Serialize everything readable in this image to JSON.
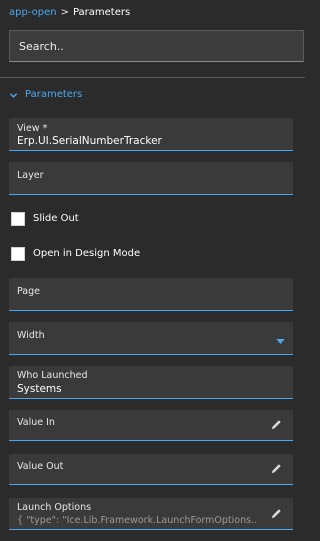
{
  "breadcrumb": {
    "parent": "app-open",
    "separator": ">",
    "current": "Parameters"
  },
  "search": {
    "placeholder": "Search.."
  },
  "section": {
    "title": "Parameters",
    "expanded": true
  },
  "fields": {
    "view": {
      "label": "View *",
      "value": "Erp.UI.SerialNumberTracker"
    },
    "layer": {
      "label": "Layer",
      "value": ""
    },
    "slide_out": {
      "label": "Slide Out",
      "checked": false
    },
    "open_in_design_mode": {
      "label": "Open in Design Mode",
      "checked": false
    },
    "page": {
      "label": "Page",
      "value": ""
    },
    "width": {
      "label": "Width",
      "value": ""
    },
    "who_launched": {
      "label": "Who Launched",
      "value": "Systems"
    },
    "value_in": {
      "label": "Value In",
      "value": ""
    },
    "value_out": {
      "label": "Value Out",
      "value": ""
    },
    "launch_options": {
      "label": "Launch Options",
      "value": "{ \"type\": \"Ice.Lib.Framework.LaunchFormOptions..."
    }
  },
  "colors": {
    "accent": "#4aa8f0",
    "background": "#2b2b2b",
    "field_bg": "#3a3a3a"
  },
  "icons": {
    "section_toggle": "chevron-down-icon",
    "edit": "pencil-icon",
    "dropdown": "caret-down-icon"
  }
}
